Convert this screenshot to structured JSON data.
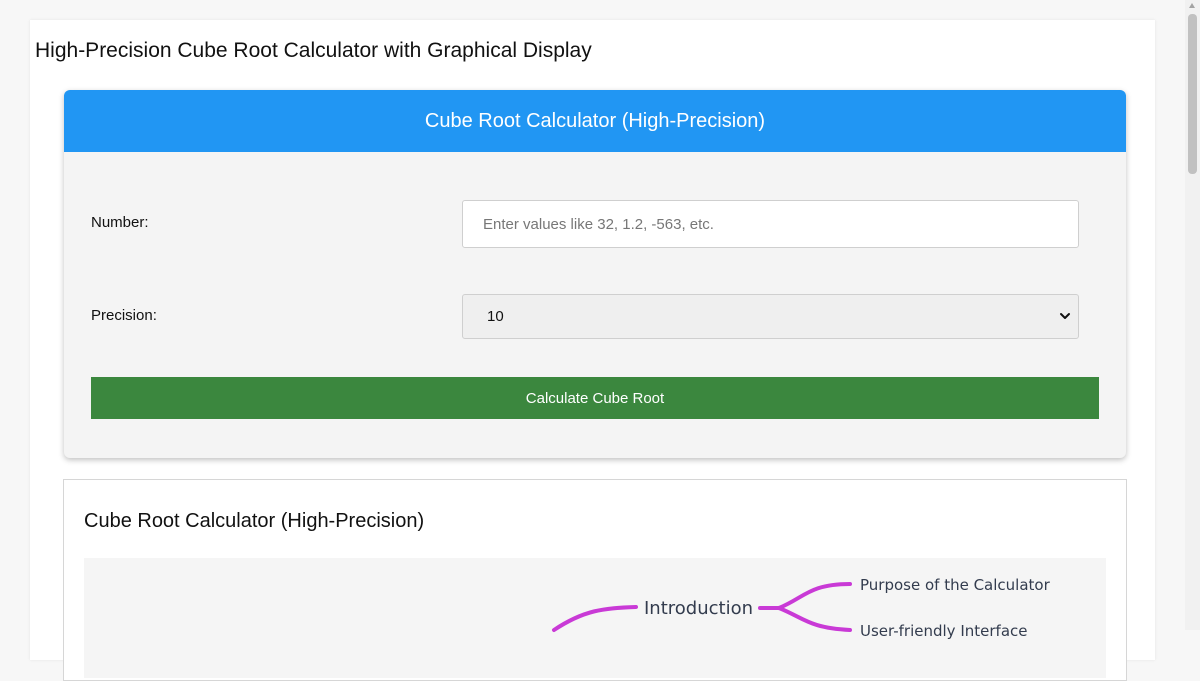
{
  "page": {
    "title": "High-Precision Cube Root Calculator with Graphical Display"
  },
  "calculator": {
    "header": "Cube Root Calculator (High-Precision)",
    "number_label": "Number:",
    "number_value": "",
    "number_placeholder": "Enter values like 32, 1.2, -563, etc.",
    "precision_label": "Precision:",
    "precision_selected": "10",
    "button_label": "Calculate Cube Root",
    "colors": {
      "header": "#2196f3",
      "button": "#3b873e"
    }
  },
  "info": {
    "title": "Cube Root Calculator (High-Precision)",
    "mindmap": {
      "central": "Introduction",
      "branches": [
        "Purpose of the Calculator",
        "User-friendly Interface"
      ],
      "branch_color": "#c93ad6"
    }
  }
}
